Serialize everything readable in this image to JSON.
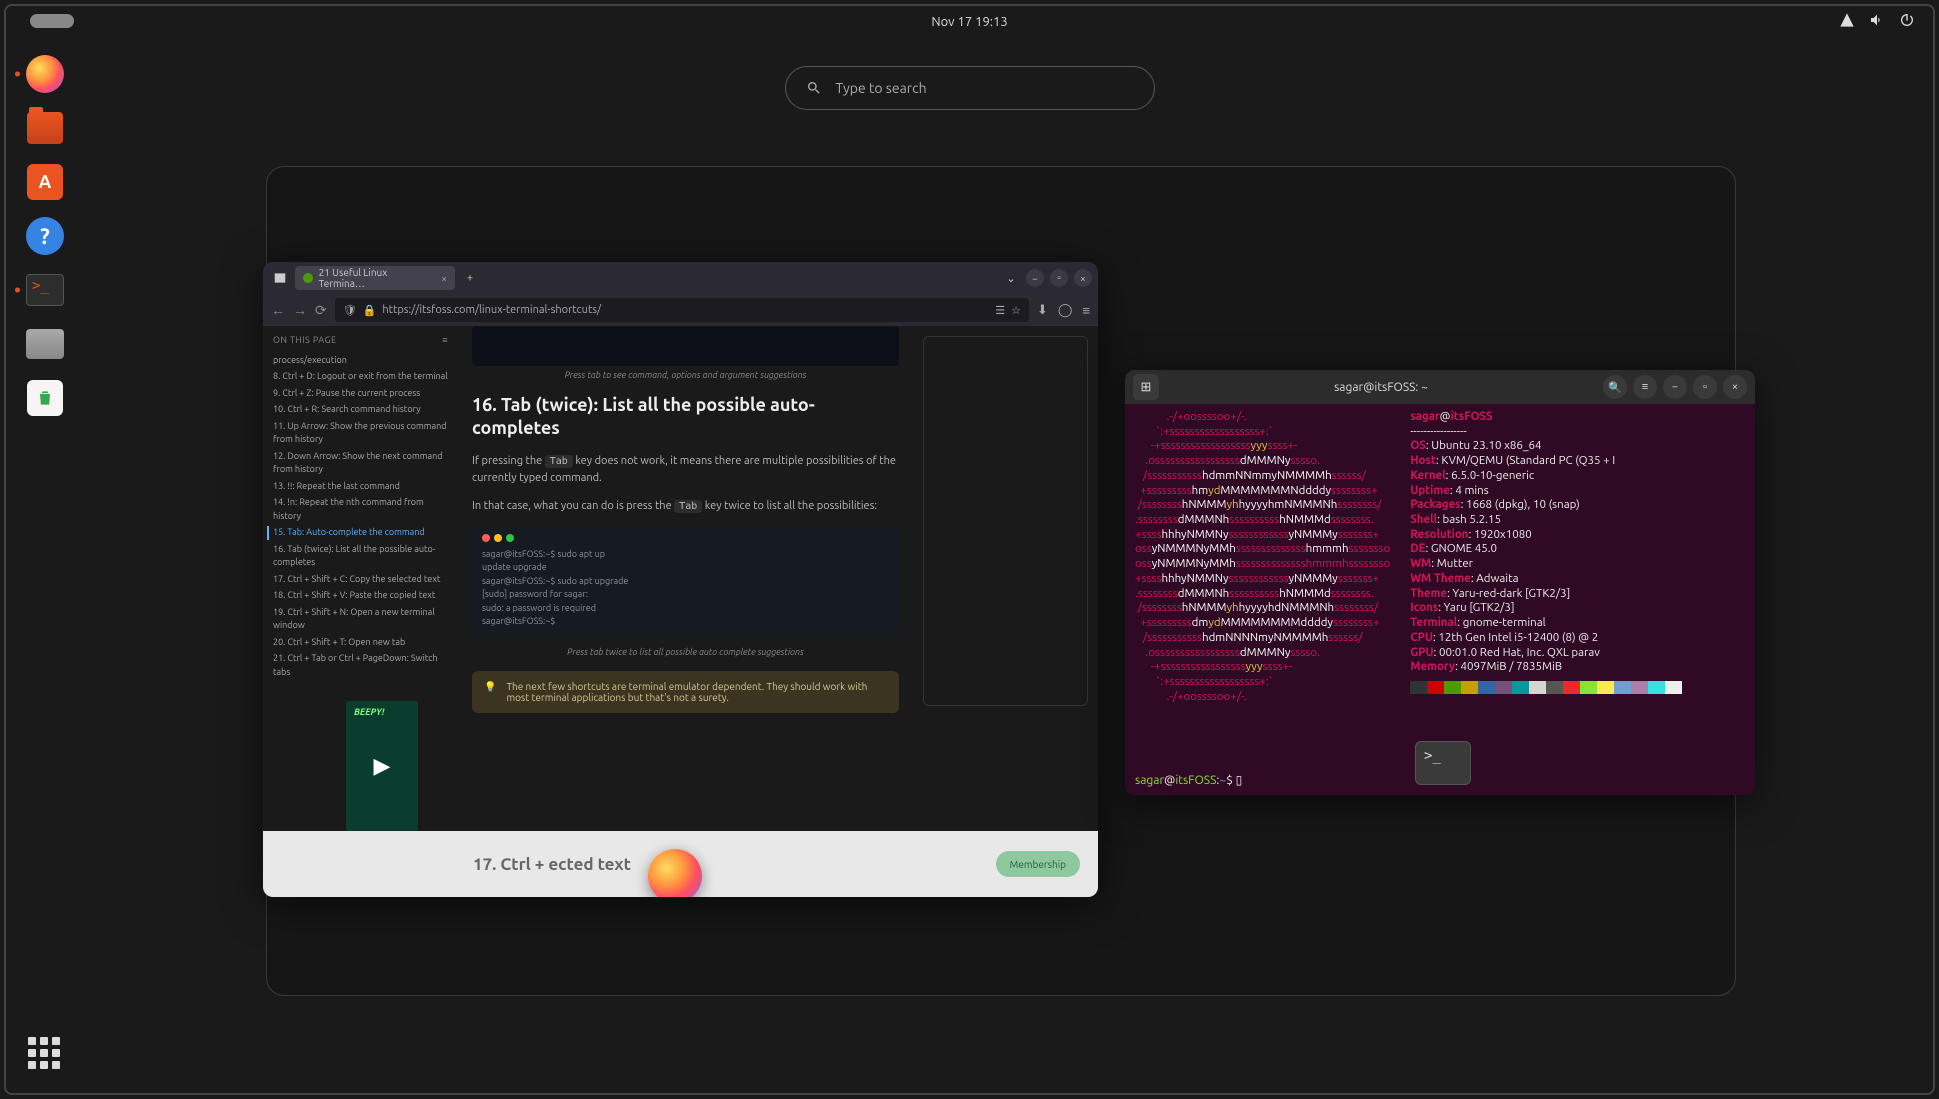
{
  "topbar": {
    "datetime": "Nov 17  19:13"
  },
  "search": {
    "placeholder": "Type to search"
  },
  "dock": {
    "items": [
      {
        "name": "firefox"
      },
      {
        "name": "files"
      },
      {
        "name": "software"
      },
      {
        "name": "help"
      },
      {
        "name": "terminal"
      },
      {
        "name": "disks"
      },
      {
        "name": "trash"
      }
    ]
  },
  "firefox": {
    "tab_title": "21 Useful Linux Termina…",
    "url": "https://itsfoss.com/linux-terminal-shortcuts/",
    "toc_header": "ON THIS PAGE",
    "toc": [
      "process/execution",
      "8. Ctrl + D: Logout or exit from the terminal",
      "9. Ctrl + Z: Pause the current process",
      "10. Ctrl + R: Search command history",
      "11. Up Arrow: Show the previous command from history",
      "12. Down Arrow: Show the next command from history",
      "13. !!: Repeat the last command",
      "14. !n: Repeat the nth command from history",
      "15. Tab: Auto-complete the command",
      "16. Tab (twice): List all the possible auto-completes",
      "17. Ctrl + Shift + C: Copy the selected text",
      "18. Ctrl + Shift + V: Paste the copied text",
      "19. Ctrl + Shift + N: Open a new terminal window",
      "20. Ctrl + Shift + T: Open new tab",
      "21. Ctrl + Tab or Ctrl + PageDown: Switch tabs"
    ],
    "toc_active_index": 8,
    "caption1": "Press tab to see command, options and argument suggestions",
    "h2": "16. Tab (twice): List all the possible auto-completes",
    "p1a": "If pressing the ",
    "kbd1": "Tab",
    "p1b": " key does not work, it means there are multiple possibilities of the currently typed command.",
    "p2a": "In that case, what you can do is press the ",
    "kbd2": "Tab",
    "p2b": " key twice to list all the possibilities:",
    "code": [
      "sagar@itsFOSS:~$ sudo apt up",
      "update   upgrade",
      "sagar@itsFOSS:~$ sudo apt upgrade",
      "[sudo] password for sagar:",
      "sudo: a password is required",
      "sagar@itsFOSS:~$ "
    ],
    "caption2": "Press tab twice to list all possible auto complete suggestions",
    "note": "The next few shortcuts are terminal emulator dependent. They should work with most terminal applications but that's not a surety.",
    "beepy": "BEEPY!",
    "h17": "17. Ctrl +                             ected text",
    "membership": "Membership"
  },
  "terminal": {
    "title": "sagar@itsFOSS: ~",
    "user": "sagar",
    "host": "itsFOSS",
    "info": [
      [
        "",
        ""
      ],
      [
        "OS",
        "Ubuntu 23.10 x86_64"
      ],
      [
        "Host",
        "KVM/QEMU (Standard PC (Q35 + I"
      ],
      [
        "Kernel",
        "6.5.0-10-generic"
      ],
      [
        "Uptime",
        "4 mins"
      ],
      [
        "Packages",
        "1668 (dpkg), 10 (snap)"
      ],
      [
        "Shell",
        "bash 5.2.15"
      ],
      [
        "Resolution",
        "1920x1080"
      ],
      [
        "DE",
        "GNOME 45.0"
      ],
      [
        "WM",
        "Mutter"
      ],
      [
        "WM Theme",
        "Adwaita"
      ],
      [
        "Theme",
        "Yaru-red-dark [GTK2/3]"
      ],
      [
        "Icons",
        "Yaru [GTK2/3]"
      ],
      [
        "Terminal",
        "gnome-terminal"
      ],
      [
        "CPU",
        "12th Gen Intel i5-12400 (8) @ 2"
      ],
      [
        "GPU",
        "00:01.0 Red Hat, Inc. QXL parav"
      ],
      [
        "Memory",
        "4097MiB / 7835MiB"
      ]
    ],
    "swatches": [
      "#2e3436",
      "#cc0000",
      "#4e9a06",
      "#c4a000",
      "#3465a4",
      "#75507b",
      "#06989a",
      "#d3d7cf",
      "#555753",
      "#ef2929",
      "#8ae234",
      "#fce94f",
      "#729fcf",
      "#ad7fa8",
      "#34e2e2",
      "#eeeeec"
    ],
    "prompt": "sagar@itsFOSS:~$ ▯"
  }
}
